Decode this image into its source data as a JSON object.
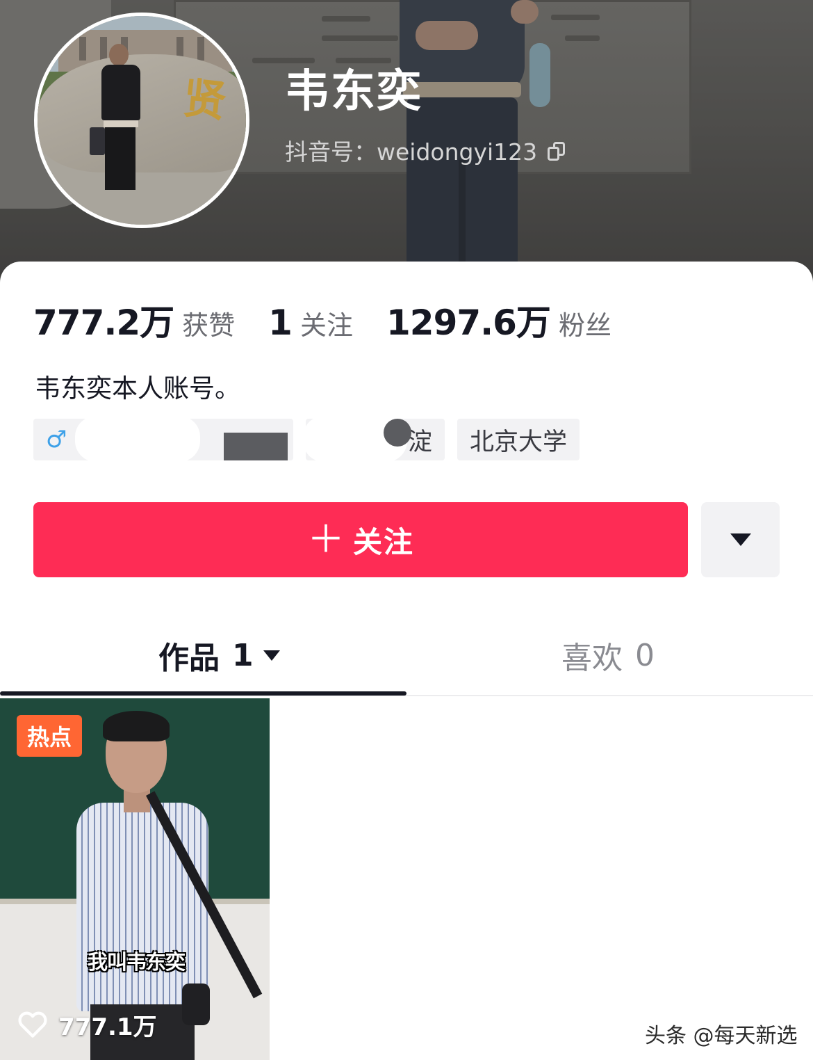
{
  "profile": {
    "name": "韦东奕",
    "id_label": "抖音号：",
    "id_value": "weidongyi123",
    "bio": "韦东奕本人账号。"
  },
  "stats": [
    {
      "value": "777.2万",
      "label": "获赞"
    },
    {
      "value": "1",
      "label": "关注"
    },
    {
      "value": "1297.6万",
      "label": "粉丝"
    }
  ],
  "tags": {
    "gender_icon": "male-icon",
    "gender_symbol": "♂",
    "location_partial": "淀",
    "school": "北京大学"
  },
  "actions": {
    "follow_plus": "＋",
    "follow_label": "关注",
    "more_icon": "triangle-down-icon"
  },
  "tabs": [
    {
      "label": "作品",
      "count": "1",
      "active": true
    },
    {
      "label": "喜欢",
      "count": "0",
      "active": false
    }
  ],
  "video": {
    "badge": "热点",
    "caption": "我叫韦东奕",
    "likes": "777.1万"
  },
  "watermark": "头条 @每天新选",
  "colors": {
    "accent": "#fe2c55",
    "badge": "#ff6633",
    "text": "#161823",
    "muted": "#6b6c72"
  }
}
